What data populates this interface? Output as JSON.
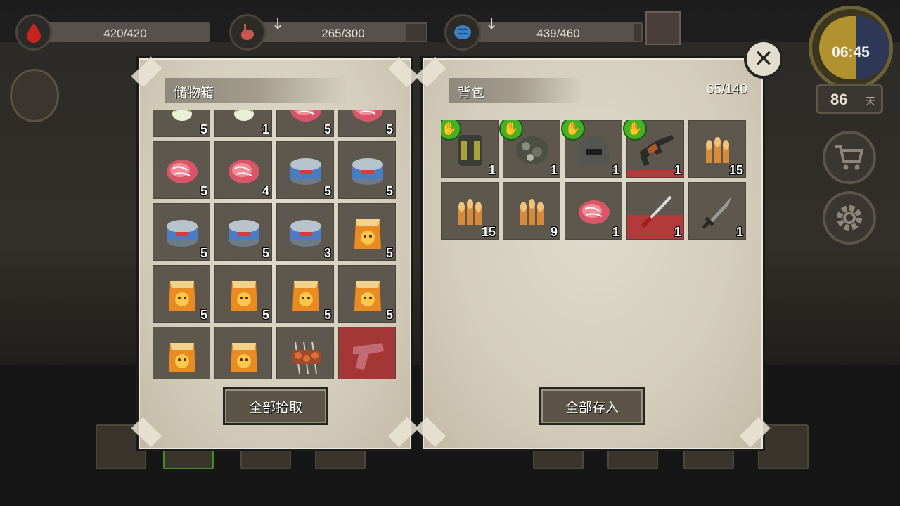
{
  "hud": {
    "health": {
      "value": "420/420",
      "ratio": 1.0,
      "icon": "blood-drop-icon",
      "color": "#c8241f"
    },
    "hunger": {
      "value": "265/300",
      "ratio": 0.883,
      "icon": "stomach-icon",
      "color": "#c9574b"
    },
    "thirst": {
      "value": "439/460",
      "ratio": 0.954,
      "icon": "brain-icon",
      "color": "#3b84c4"
    },
    "clock_time": "06:45",
    "day_count": "86",
    "day_unit": "天"
  },
  "storage": {
    "title": "储物箱",
    "take_all_label": "全部拾取",
    "items": [
      {
        "name": "green-onion",
        "count": "5"
      },
      {
        "name": "green-onion",
        "count": "1"
      },
      {
        "name": "raw-meat",
        "count": "5"
      },
      {
        "name": "raw-meat",
        "count": "5"
      },
      {
        "name": "raw-meat",
        "count": "5"
      },
      {
        "name": "raw-meat",
        "count": "4"
      },
      {
        "name": "canned-food",
        "count": "5"
      },
      {
        "name": "canned-food",
        "count": "5"
      },
      {
        "name": "canned-food",
        "count": "5"
      },
      {
        "name": "canned-food",
        "count": "5"
      },
      {
        "name": "canned-food",
        "count": "3"
      },
      {
        "name": "chips-bag",
        "count": "5"
      },
      {
        "name": "chips-bag",
        "count": "5"
      },
      {
        "name": "chips-bag",
        "count": "5"
      },
      {
        "name": "chips-bag",
        "count": "5"
      },
      {
        "name": "chips-bag",
        "count": "5"
      },
      {
        "name": "chips-bag",
        "count": ""
      },
      {
        "name": "chips-bag",
        "count": ""
      },
      {
        "name": "skewers",
        "count": ""
      },
      {
        "name": "pistol",
        "count": ""
      }
    ]
  },
  "backpack": {
    "title": "背包",
    "capacity": "65/140",
    "store_all_label": "全部存入",
    "items": [
      {
        "name": "backpack-gear",
        "count": "1",
        "equipped": true
      },
      {
        "name": "camo-armor",
        "count": "1",
        "equipped": true
      },
      {
        "name": "tactical-helmet",
        "count": "1",
        "equipped": true
      },
      {
        "name": "assault-rifle",
        "count": "1",
        "equipped": true
      },
      {
        "name": "bullets",
        "count": "15",
        "equipped": false
      },
      {
        "name": "bullets",
        "count": "15",
        "equipped": false
      },
      {
        "name": "bullets",
        "count": "9",
        "equipped": false
      },
      {
        "name": "raw-meat",
        "count": "1",
        "equipped": false
      },
      {
        "name": "katana",
        "count": "1",
        "equipped": false
      },
      {
        "name": "dagger",
        "count": "1",
        "equipped": false
      }
    ]
  }
}
